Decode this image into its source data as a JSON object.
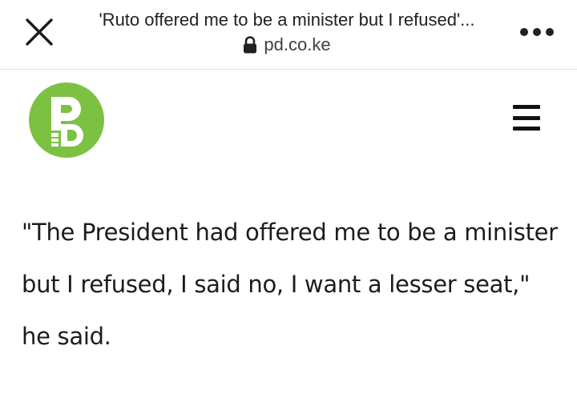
{
  "browser": {
    "title": "'Ruto offered me to be a minister but I refused'...",
    "url": "pd.co.ke",
    "icons": {
      "close": "close-icon",
      "lock": "lock-icon",
      "more": "more-options-icon"
    }
  },
  "site": {
    "logo_icon": "pd-logo",
    "brand_color": "#7dc142",
    "menu_icon": "hamburger-menu-icon"
  },
  "article": {
    "lines": [
      "\"The President had offered me to be a minister",
      "but I refused, I said no, I want a lesser seat,\"",
      "he said."
    ]
  }
}
